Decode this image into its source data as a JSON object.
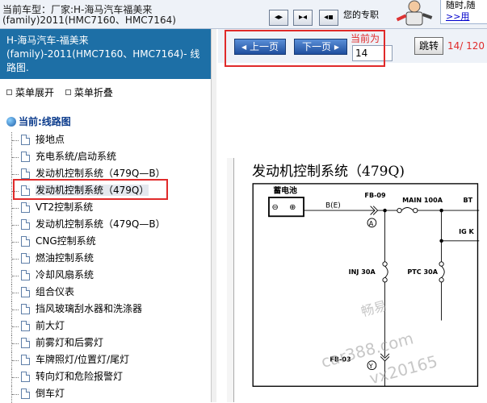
{
  "topbar": {
    "car_type_prefix": "当前车型：",
    "car_type_text": "厂家:H-海马汽车福美来(family)2011(HMC7160、HMC7164)",
    "expert_text": "您的专职",
    "promo_line1": "随时,随",
    "promo_link": ">>用"
  },
  "model_header": {
    "line1": "H-海马汽车-福美来",
    "line2": "(family)-2011(HMC7160、HMC7164)- 线",
    "line3": "路图."
  },
  "menu": {
    "expand": "菜单展开",
    "collapse": "菜单折叠"
  },
  "tree": {
    "root": "当前:线路图",
    "items": [
      "接地点",
      "充电系统/启动系统",
      "发动机控制系统（479Q—B）",
      "发动机控制系统（479Q）",
      "VT2控制系统",
      "发动机控制系统（479Q—B）",
      "CNG控制系统",
      "燃油控制系统",
      "冷却风扇系统",
      "组合仪表",
      "挡风玻璃刮水器和洗涤器",
      "前大灯",
      "前雾灯和后雾灯",
      "车牌照灯/位置灯/尾灯",
      "转向灯和危险报警灯",
      "倒车灯"
    ],
    "selected_index": 3
  },
  "pager": {
    "prev": "上一页",
    "next": "下一页",
    "current_label": "当前为",
    "current_value": "14",
    "jump": "跳转",
    "pages": "14/ 120"
  },
  "diagram": {
    "title": "发动机控制系统（479Q)",
    "battery": "蓄电池",
    "minus": "⊖",
    "plus": "⊕",
    "be": "B(E)",
    "fb09": "FB-09",
    "main": "MAIN 100A",
    "bt": "BT",
    "ig": "IG K",
    "circle_a": "A",
    "inj": "INJ 30A",
    "ptc": "PTC 30A",
    "fb03": "FB-03",
    "circle_y": "Y",
    "wm1": "畅易",
    "wm2": "car388.com",
    "wm3": "vx20165"
  },
  "colors": {
    "header_blue": "#1d6fa6",
    "highlight_red": "#e02a2a",
    "pager_blue": "#2a5fb0"
  }
}
